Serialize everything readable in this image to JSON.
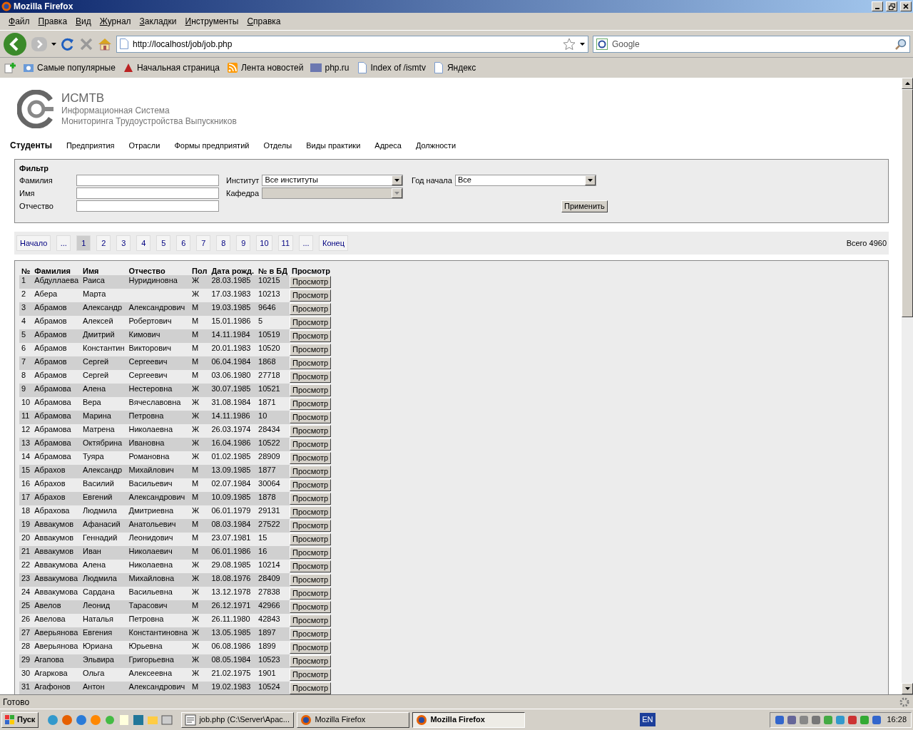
{
  "window": {
    "title": "Mozilla Firefox"
  },
  "menu": [
    "Файл",
    "Правка",
    "Вид",
    "Журнал",
    "Закладки",
    "Инструменты",
    "Справка"
  ],
  "address": {
    "value": "http://localhost/job/job.php"
  },
  "search": {
    "placeholder": "Google"
  },
  "bookmarks": [
    {
      "label": "Самые популярные",
      "kind": "smart"
    },
    {
      "label": "Начальная страница",
      "kind": "start"
    },
    {
      "label": "Лента новостей",
      "kind": "feed"
    },
    {
      "label": "php.ru",
      "kind": "php"
    },
    {
      "label": "Index of /ismtv",
      "kind": "page"
    },
    {
      "label": "Яндекс",
      "kind": "page"
    }
  ],
  "site": {
    "title": "ИСМТВ",
    "subtitle": [
      "Информационная Система",
      "Мониторинга Трудоустройства Выпускников"
    ]
  },
  "nav": [
    {
      "label": "Студенты",
      "selected": true
    },
    {
      "label": "Предприятия",
      "selected": false
    },
    {
      "label": "Отрасли",
      "selected": false
    },
    {
      "label": "Формы предприятий",
      "selected": false
    },
    {
      "label": "Отделы",
      "selected": false
    },
    {
      "label": "Виды практики",
      "selected": false
    },
    {
      "label": "Адреса",
      "selected": false
    },
    {
      "label": "Должности",
      "selected": false
    }
  ],
  "filter": {
    "title": "Фильтр",
    "fields": [
      {
        "label": "Фамилия"
      },
      {
        "label": "Имя"
      },
      {
        "label": "Отчество"
      }
    ],
    "selects": [
      {
        "label": "Институт",
        "value": "Все институты",
        "disabled": false
      },
      {
        "label": "Кафедра",
        "disabled": true
      }
    ],
    "year": {
      "label": "Год начала",
      "value": "Все"
    },
    "apply": "Применить"
  },
  "pager": {
    "items": [
      {
        "label": "Начало",
        "selected": false
      },
      {
        "label": "...",
        "selected": false
      },
      {
        "label": "1",
        "selected": true
      },
      {
        "label": "2",
        "selected": false
      },
      {
        "label": "3",
        "selected": false
      },
      {
        "label": "4",
        "selected": false
      },
      {
        "label": "5",
        "selected": false
      },
      {
        "label": "6",
        "selected": false
      },
      {
        "label": "7",
        "selected": false
      },
      {
        "label": "8",
        "selected": false
      },
      {
        "label": "9",
        "selected": false
      },
      {
        "label": "10",
        "selected": false
      },
      {
        "label": "11",
        "selected": false
      },
      {
        "label": "...",
        "selected": false
      },
      {
        "label": "Конец",
        "selected": false
      }
    ],
    "total": "Всего 4960"
  },
  "table": {
    "columns": [
      "№",
      "Фамилия",
      "Имя",
      "Отчество",
      "Пол",
      "Дата рожд.",
      "№ в БД",
      "Просмотр"
    ],
    "rows": [
      [
        "1",
        "Абдуллаева",
        "Раиса",
        "Нуридиновна",
        "Ж",
        "28.03.1985",
        "10215",
        "Просмотр"
      ],
      [
        "2",
        "Абера",
        "Марта",
        null,
        "Ж",
        "17.03.1983",
        "10213",
        "Просмотр"
      ],
      [
        "3",
        "Абрамов",
        "Александр",
        "Александрович",
        "М",
        "19.03.1985",
        "9646",
        "Просмотр"
      ],
      [
        "4",
        "Абрамов",
        "Алексей",
        "Робертович",
        "М",
        "15.01.1986",
        "5",
        "Просмотр"
      ],
      [
        "5",
        "Абрамов",
        "Дмитрий",
        "Кимович",
        "М",
        "14.11.1984",
        "10519",
        "Просмотр"
      ],
      [
        "6",
        "Абрамов",
        "Константин",
        "Викторович",
        "М",
        "20.01.1983",
        "10520",
        "Просмотр"
      ],
      [
        "7",
        "Абрамов",
        "Сергей",
        "Сергеевич",
        "М",
        "06.04.1984",
        "1868",
        "Просмотр"
      ],
      [
        "8",
        "Абрамов",
        "Сергей",
        "Сергеевич",
        "М",
        "03.06.1980",
        "27718",
        "Просмотр"
      ],
      [
        "9",
        "Абрамова",
        "Алена",
        "Нестеровна",
        "Ж",
        "30.07.1985",
        "10521",
        "Просмотр"
      ],
      [
        "10",
        "Абрамова",
        "Вера",
        "Вячеславовна",
        "Ж",
        "31.08.1984",
        "1871",
        "Просмотр"
      ],
      [
        "11",
        "Абрамова",
        "Марина",
        "Петровна",
        "Ж",
        "14.11.1986",
        "10",
        "Просмотр"
      ],
      [
        "12",
        "Абрамова",
        "Матрена",
        "Николаевна",
        "Ж",
        "26.03.1974",
        "28434",
        "Просмотр"
      ],
      [
        "13",
        "Абрамова",
        "Октябрина",
        "Ивановна",
        "Ж",
        "16.04.1986",
        "10522",
        "Просмотр"
      ],
      [
        "14",
        "Абрамова",
        "Туяра",
        "Романовна",
        "Ж",
        "01.02.1985",
        "28909",
        "Просмотр"
      ],
      [
        "15",
        "Абрахов",
        "Александр",
        "Михайлович",
        "М",
        "13.09.1985",
        "1877",
        "Просмотр"
      ],
      [
        "16",
        "Абрахов",
        "Василий",
        "Васильевич",
        "М",
        "02.07.1984",
        "30064",
        "Просмотр"
      ],
      [
        "17",
        "Абрахов",
        "Евгений",
        "Александрович",
        "М",
        "10.09.1985",
        "1878",
        "Просмотр"
      ],
      [
        "18",
        "Абрахова",
        "Людмила",
        "Дмитриевна",
        "Ж",
        "06.01.1979",
        "29131",
        "Просмотр"
      ],
      [
        "19",
        "Аввакумов",
        "Афанасий",
        "Анатольевич",
        "М",
        "08.03.1984",
        "27522",
        "Просмотр"
      ],
      [
        "20",
        "Аввакумов",
        "Геннадий",
        "Леонидович",
        "М",
        "23.07.1981",
        "15",
        "Просмотр"
      ],
      [
        "21",
        "Аввакумов",
        "Иван",
        "Николаевич",
        "М",
        "06.01.1986",
        "16",
        "Просмотр"
      ],
      [
        "22",
        "Аввакумова",
        "Алена",
        "Николаевна",
        "Ж",
        "29.08.1985",
        "10214",
        "Просмотр"
      ],
      [
        "23",
        "Аввакумова",
        "Людмила",
        "Михайловна",
        "Ж",
        "18.08.1976",
        "28409",
        "Просмотр"
      ],
      [
        "24",
        "Аввакумова",
        "Сардана",
        "Васильевна",
        "Ж",
        "13.12.1978",
        "27838",
        "Просмотр"
      ],
      [
        "25",
        "Авелов",
        "Леонид",
        "Тарасович",
        "М",
        "26.12.1971",
        "42966",
        "Просмотр"
      ],
      [
        "26",
        "Авелова",
        "Наталья",
        "Петровна",
        "Ж",
        "26.11.1980",
        "42843",
        "Просмотр"
      ],
      [
        "27",
        "Аверьянова",
        "Евгения",
        "Константиновна",
        "Ж",
        "13.05.1985",
        "1897",
        "Просмотр"
      ],
      [
        "28",
        "Аверьянова",
        "Юриана",
        "Юрьевна",
        "Ж",
        "06.08.1986",
        "1899",
        "Просмотр"
      ],
      [
        "29",
        "Агапова",
        "Эльвира",
        "Григорьевна",
        "Ж",
        "08.05.1984",
        "10523",
        "Просмотр"
      ],
      [
        "30",
        "Агаркова",
        "Ольга",
        "Алексеевна",
        "Ж",
        "21.02.1975",
        "1901",
        "Просмотр"
      ],
      [
        "31",
        "Агафонов",
        "Антон",
        "Александрович",
        "М",
        "19.02.1983",
        "10524",
        "Просмотр"
      ]
    ]
  },
  "status_bar": "Готово",
  "taskbar": {
    "start": "Пуск",
    "tasks": [
      {
        "label": "job.php (C:\\Server\\Apac...",
        "kind": "editor",
        "selected": false
      },
      {
        "label": "Mozilla Firefox",
        "kind": "browser",
        "selected": false
      },
      {
        "label": "Mozilla Firefox",
        "kind": "browser",
        "selected": true
      }
    ],
    "lang": "EN",
    "clock": "16:28"
  }
}
